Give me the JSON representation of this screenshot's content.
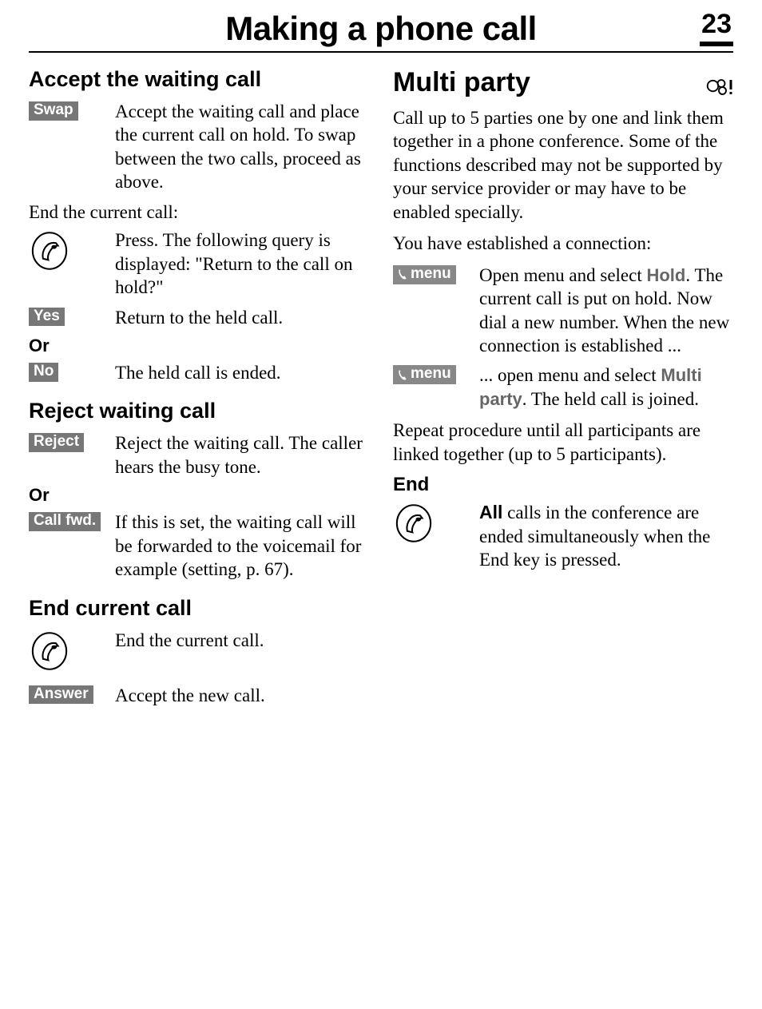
{
  "header": {
    "title": "Making a phone call",
    "page_number": "23"
  },
  "left": {
    "accept_waiting": {
      "heading": "Accept the waiting call",
      "swap_label": "Swap",
      "swap_desc": "Accept the waiting call and place the current call on hold. To swap between the two calls, proceed as above.",
      "end_current_intro": "End the current call:",
      "press_desc": "Press. The following query is displayed: \"Return to the call on hold?\"",
      "yes_label": "Yes",
      "yes_desc": "Return to the held call.",
      "or": "Or",
      "no_label": "No",
      "no_desc": "The held call is ended."
    },
    "reject_waiting": {
      "heading": "Reject waiting call",
      "reject_label": "Reject",
      "reject_desc": "Reject the waiting call. The caller hears the busy tone.",
      "or": "Or",
      "callfwd_label": "Call fwd.",
      "callfwd_desc": "If this is set, the waiting call will be forwarded to the voicemail for example (setting, p. 67)."
    },
    "end_current": {
      "heading": "End current call",
      "end_desc": "End the current call.",
      "answer_label": "Answer",
      "answer_desc": "Accept the new call."
    }
  },
  "right": {
    "multi_party": {
      "heading": "Multi party",
      "intro": "Call up to 5 parties one by one and link them together in a phone conference. Some of the functions described may not be supported by your service provider or may have to be enabled specially.",
      "established": "You have established a connection:",
      "menu_label": "menu",
      "hold_word": "Hold",
      "hold_desc_prefix": "Open menu and select ",
      "hold_desc_suffix": ". The current call is put on hold. Now dial a new number. When the new connection is established ...",
      "mp_desc_prefix": "... open menu and select ",
      "mp_word": "Multi party",
      "mp_desc_suffix": ". The held call is joined.",
      "repeat": "Repeat procedure until all participants are linked together (up to 5 participants).",
      "end_heading": "End",
      "all_word": "All",
      "end_desc_suffix": " calls in the conference are ended simultaneously when the End key is pressed."
    }
  }
}
